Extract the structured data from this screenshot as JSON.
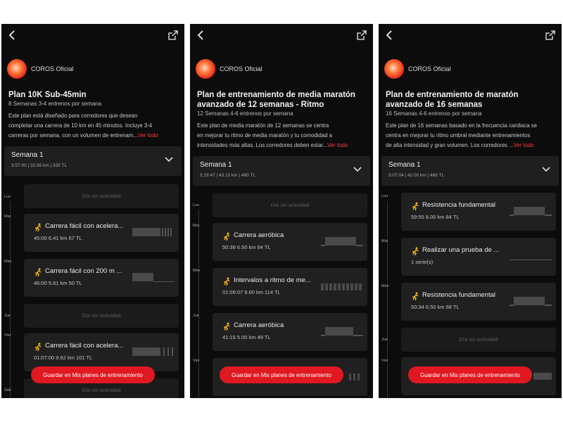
{
  "brand_red": "#e01822",
  "screens": [
    {
      "author": "COROS Oficial",
      "title": "Plan 10K Sub-45min",
      "meta": "8 Semanas   3-4 entrenos por semana",
      "desc": [
        "Este plan está diseñado para corredores que desean",
        "completar una carrera de 10 km en 45 minutos. Incluye 3-4",
        "carreras por semana, con un volumen de entrenam..."
      ],
      "more": "Ver todo",
      "week": {
        "title": "Semana 1",
        "stats": "3:57:00 | 32.85 km | 335 TL"
      },
      "days": [
        "Lun",
        "Mar",
        "Mier",
        "Jue",
        "Vier",
        "Sáb"
      ],
      "cards": [
        {
          "rest": "Día sin actividad"
        },
        {
          "title": "Carrera fácil con acelera...",
          "stats": "45:00   6.41 km   67 TL"
        },
        {
          "title": "Carrera fácil con 200 m ...",
          "stats": "46:00   5.61 km   50 TL"
        },
        {
          "rest": "Día sin actividad"
        },
        {
          "title": "Carrera fácil con acelera...",
          "stats": "01:07:00   9.62 km   101 TL"
        },
        {
          "rest": "Día sin actividad"
        }
      ],
      "save": "Guardar en Mis planes de entrenamiento"
    },
    {
      "author": "COROS Oficial",
      "title": "Plan de entrenamiento de media maratón avanzado de 12 semanas - Ritmo",
      "meta": "12 Semanas   4-6 entrenos por semana",
      "desc": [
        "Este plan de media maratón de 12 semanas se centra",
        "en mejorar tu ritmo de media maratón y tu comodidad a",
        "intensidades más altas. Los corredores deben estar..."
      ],
      "more": "Ver todo",
      "week": {
        "title": "Semana 1",
        "stats": "5:19:47 | 43.10 km | 480 TL"
      },
      "days": [
        "Lun",
        "Mar",
        "Mier",
        "Jue",
        "Vier"
      ],
      "cards": [
        {
          "rest": "Día sin actividad"
        },
        {
          "title": "Carrera aeróbica",
          "stats": "50:38   6.50 km   64 TL"
        },
        {
          "title": "Intervalos a ritmo de me...",
          "stats": "01:06:07   9.60 km   114 TL"
        },
        {
          "title": "Carrera aeróbica",
          "stats": "41:15   5.00 km   49 TL"
        },
        {
          "title": "",
          "stats": ""
        }
      ],
      "save": "Guardar en Mis planes de entrenamiento"
    },
    {
      "author": "COROS Oficial",
      "title": "Plan de entrenamiento de maratón avanzado de 16 semanas",
      "meta": "16 Semanas   4-6 entrenos por semana",
      "desc": [
        "Este plan de 16 semanas basado en la frecuencia cardiaca se",
        "centra en mejorar tu ritmo umbral mediante entrenamientos",
        "de alta intensidad y gran volumen. Los corredores ..."
      ],
      "more": "Ver todo",
      "week": {
        "title": "Semana 1",
        "stats": "5:07:04 | 42.00 km | 466 TL"
      },
      "days": [
        "Lun",
        "Mar",
        "Mier",
        "Jue",
        "Vier"
      ],
      "cards": [
        {
          "title": "Resistencia fundamental",
          "stats": "59:55   8.00 km   84 TL"
        },
        {
          "title": "Realizar una prueba de ...",
          "stats": "1 serie(s)"
        },
        {
          "title": "Resistencia fundamental",
          "stats": "50:34   6.50 km   68 TL"
        },
        {
          "rest": "Día sin actividad"
        },
        {
          "title": "",
          "stats": ""
        }
      ],
      "save": "Guardar en Mis planes de entrenamiento"
    }
  ]
}
